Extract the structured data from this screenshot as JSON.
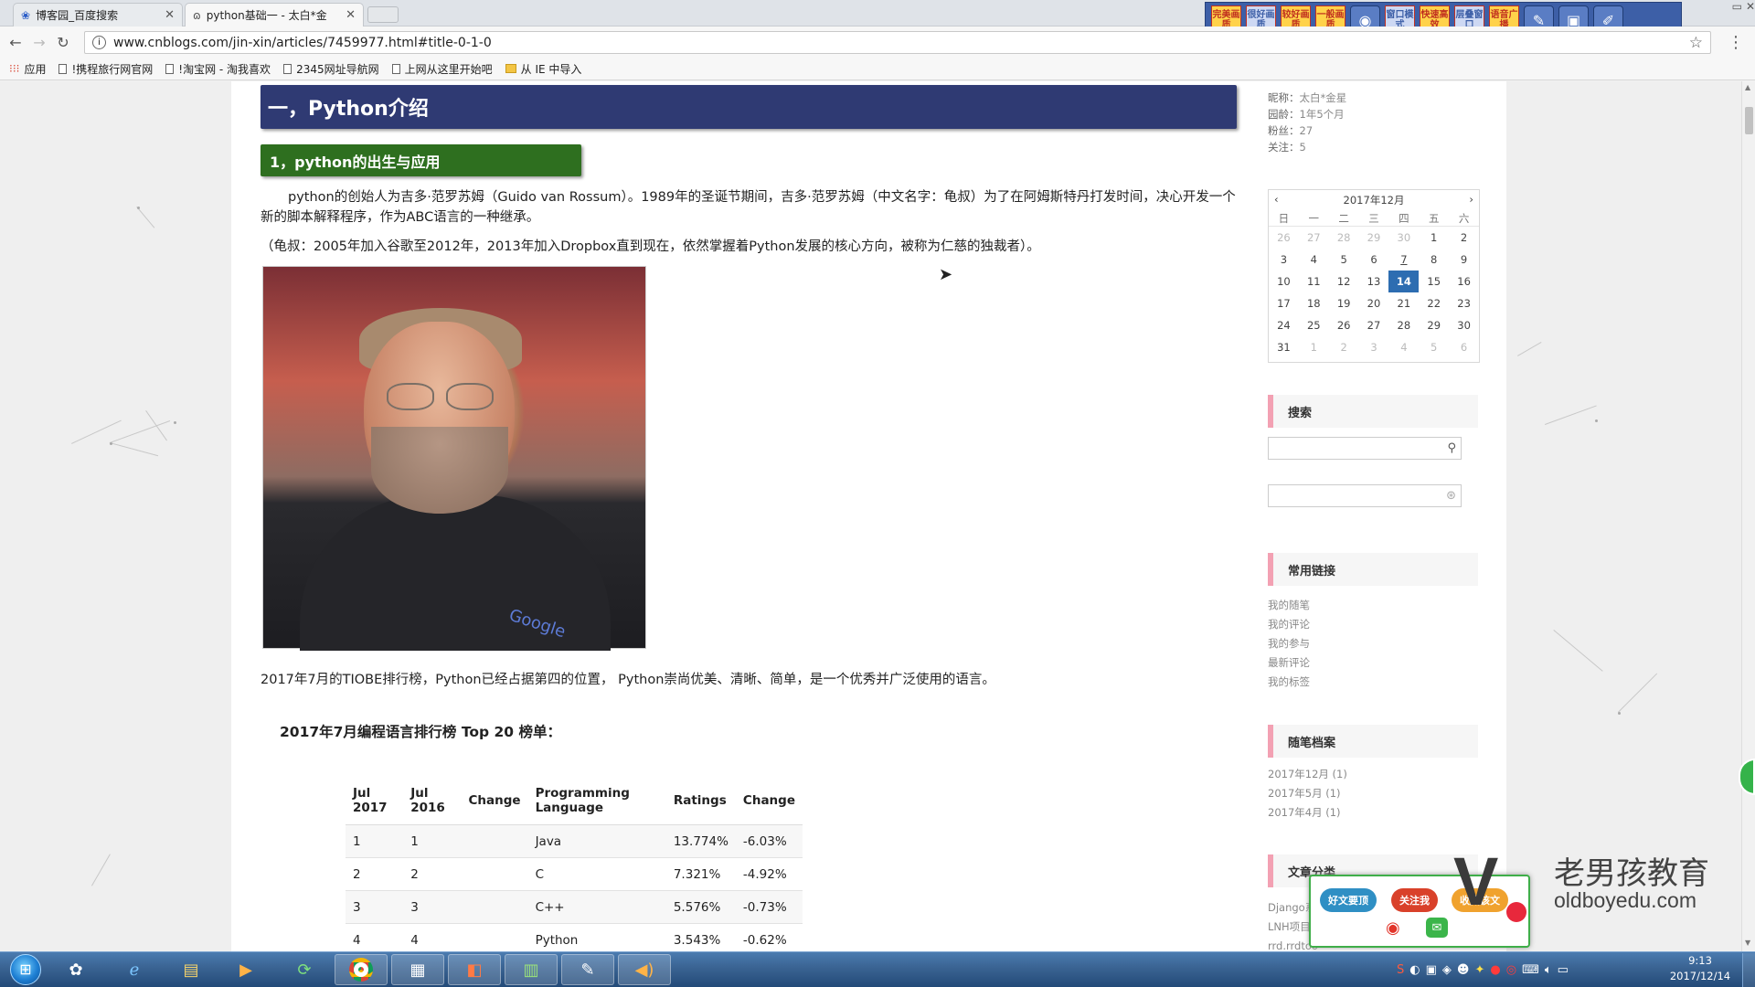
{
  "browser": {
    "tabs": [
      {
        "title": "博客园_百度搜索",
        "active": false
      },
      {
        "title": "python基础一 - 太白*金",
        "active": true
      }
    ],
    "url": "www.cnblogs.com/jin-xin/articles/7459977.html#title-0-1-0",
    "bookmarks": [
      "应用",
      "!携程旅行网官网",
      "!淘宝网 - 淘我喜欢",
      "2345网址导航网",
      "上网从这里开始吧",
      "从 IE 中导入"
    ]
  },
  "extension_toolbar": {
    "buttons": [
      "完美画质",
      "很好画质",
      "较好画质",
      "一般画质",
      "窗口模式",
      "快速高效",
      "层叠窗口",
      "语音广播"
    ]
  },
  "article": {
    "heading": "一，Python介绍",
    "subheading": "1，python的出生与应用",
    "para1": "python的创始人为吉多·范罗苏姆（Guido van Rossum）。1989年的圣诞节期间，吉多·范罗苏姆（中文名字：龟叔）为了在阿姆斯特丹打发时间，决心开发一个新的脚本解释程序，作为ABC语言的一种继承。",
    "para2": "（龟叔：2005年加入谷歌至2012年，2013年加入Dropbox直到现在，依然掌握着Python发展的核心方向，被称为仁慈的独裁者）。",
    "photo_logo": "Google",
    "para3": "2017年7月的TIOBE排行榜，Python已经占据第四的位置， Python崇尚优美、清晰、简单，是一个优秀并广泛使用的语言。",
    "table_title": "2017年7月编程语言排行榜 Top 20 榜单：",
    "table": {
      "headers": [
        "Jul 2017",
        "Jul 2016",
        "Change",
        "Programming Language",
        "Ratings",
        "Change"
      ],
      "rows": [
        [
          "1",
          "1",
          "",
          "Java",
          "13.774%",
          "-6.03%"
        ],
        [
          "2",
          "2",
          "",
          "C",
          "7.321%",
          "-4.92%"
        ],
        [
          "3",
          "3",
          "",
          "C++",
          "5.576%",
          "-0.73%"
        ],
        [
          "4",
          "4",
          "",
          "Python",
          "3.543%",
          "-0.62%"
        ]
      ]
    }
  },
  "sidebar": {
    "profile": [
      {
        "label": "昵称：",
        "value": "太白*金星"
      },
      {
        "label": "园龄：",
        "value": "1年5个月"
      },
      {
        "label": "粉丝：",
        "value": "27"
      },
      {
        "label": "关注：",
        "value": "5"
      }
    ],
    "calendar": {
      "title": "2017年12月",
      "prev": "‹",
      "next": "›",
      "dow": [
        "日",
        "一",
        "二",
        "三",
        "四",
        "五",
        "六"
      ],
      "days": [
        [
          "26",
          "27",
          "28",
          "29",
          "30",
          "1",
          "2"
        ],
        [
          "3",
          "4",
          "5",
          "6",
          "7",
          "8",
          "9"
        ],
        [
          "10",
          "11",
          "12",
          "13",
          "14",
          "15",
          "16"
        ],
        [
          "17",
          "18",
          "19",
          "20",
          "21",
          "22",
          "23"
        ],
        [
          "24",
          "25",
          "26",
          "27",
          "28",
          "29",
          "30"
        ],
        [
          "31",
          "1",
          "2",
          "3",
          "4",
          "5",
          "6"
        ]
      ],
      "today": "14"
    },
    "search_title": "搜索",
    "links_title": "常用链接",
    "links": [
      "我的随笔",
      "我的评论",
      "我的参与",
      "最新评论",
      "我的标签"
    ],
    "archive_title": "随笔档案",
    "archive": [
      "2017年12月 (1)",
      "2017年5月 (1)",
      "2017年4月 (1)"
    ],
    "category_title": "文章分类",
    "categories": [
      "Django系",
      "LNH项目",
      "rrd.rrdtoo"
    ]
  },
  "popup": {
    "buttons": [
      "好文要顶",
      "关注我",
      "收藏该文"
    ]
  },
  "watermark": {
    "cn": "老男孩教育",
    "en": "oldboyedu.com"
  },
  "taskbar": {
    "time": "9:13",
    "date": "2017/12/14"
  },
  "colors": {
    "heading_bg": "#2f3a73",
    "subheading_bg": "#2e6f1f",
    "today_bg": "#2d6db1",
    "section_accent": "#f3a1b3"
  }
}
